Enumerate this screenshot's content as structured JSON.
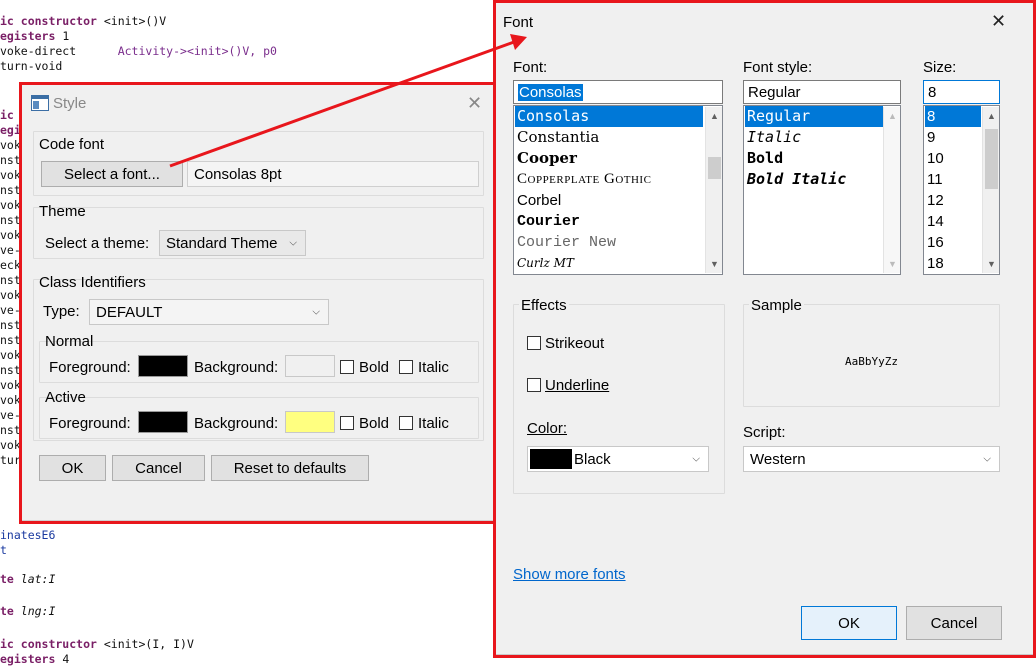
{
  "code": {
    "lines": [
      {
        "a": "ic constructor",
        "b": " <init>()V"
      },
      {
        "a": "egisters",
        "b": " 1"
      },
      {
        "a": "voke-direct",
        "b": "      Activity-><init>()V, p0"
      },
      {
        "a": "turn-void",
        "b": ""
      },
      {
        "a": "ic",
        "b": ""
      },
      {
        "a": "egi",
        "b": ""
      },
      {
        "a": "vok",
        "b": ""
      },
      {
        "a": "nst",
        "b": ""
      },
      {
        "a": "vok",
        "b": ""
      },
      {
        "a": "nst",
        "b": ""
      },
      {
        "a": "vok",
        "b": ""
      },
      {
        "a": "nst",
        "b": ""
      },
      {
        "a": "vok",
        "b": ""
      },
      {
        "a": "ve-",
        "b": ""
      },
      {
        "a": "eck",
        "b": ""
      },
      {
        "a": "nst",
        "b": ""
      },
      {
        "a": "vok",
        "b": ""
      },
      {
        "a": "ve-",
        "b": ""
      },
      {
        "a": "nst",
        "b": ""
      },
      {
        "a": "nst",
        "b": ""
      },
      {
        "a": "vok",
        "b": ""
      },
      {
        "a": "nst",
        "b": ""
      },
      {
        "a": "vok",
        "b": ""
      },
      {
        "a": "vok",
        "b": ""
      },
      {
        "a": "ve-",
        "b": ""
      },
      {
        "a": "nst",
        "b": ""
      },
      {
        "a": "vok",
        "b": ""
      },
      {
        "a": "tur",
        "b": ""
      },
      {
        "a": "inatesE6",
        "b": ""
      },
      {
        "a": "t",
        "b": ""
      },
      {
        "a": "te ",
        "b": "lat:I"
      },
      {
        "a": "te ",
        "b": "lng:I"
      },
      {
        "a": "ic constructor",
        "b": " <init>(I, I)V"
      },
      {
        "a": "egisters",
        "b": " 4"
      }
    ]
  },
  "style_dialog": {
    "title": "Style",
    "code_font": {
      "group": "Code font",
      "select_button": "Select a font...",
      "current": "Consolas 8pt"
    },
    "theme": {
      "group": "Theme",
      "label": "Select a theme:",
      "value": "Standard Theme"
    },
    "class_identifiers": {
      "group": "Class Identifiers",
      "type_label": "Type:",
      "type_value": "DEFAULT",
      "normal": {
        "group": "Normal",
        "fg_label": "Foreground:",
        "bg_label": "Background:",
        "bold": "Bold",
        "italic": "Italic",
        "fg_color": "#000000",
        "bg_color": "#f0f0f0"
      },
      "active": {
        "group": "Active",
        "fg_label": "Foreground:",
        "bg_label": "Background:",
        "bold": "Bold",
        "italic": "Italic",
        "fg_color": "#000000",
        "bg_color": "#ffff80"
      }
    },
    "buttons": {
      "ok": "OK",
      "cancel": "Cancel",
      "reset": "Reset to defaults"
    }
  },
  "font_dialog": {
    "title": "Font",
    "font": {
      "label": "Font:",
      "value": "Consolas",
      "items": [
        "Consolas",
        "Constantia",
        "Cooper",
        "Copperplate Gothic",
        "Corbel",
        "Courier",
        "Courier New",
        "Curlz MT"
      ]
    },
    "style": {
      "label": "Font style:",
      "value": "Regular",
      "items": [
        "Regular",
        "Italic",
        "Bold",
        "Bold Italic"
      ]
    },
    "size": {
      "label": "Size:",
      "value": "8",
      "items": [
        "8",
        "9",
        "10",
        "11",
        "12",
        "14",
        "16",
        "18"
      ]
    },
    "effects": {
      "group": "Effects",
      "strikeout": "Strikeout",
      "underline": "Underline",
      "color_label": "Color:",
      "color_value": "Black",
      "color_swatch": "#000000"
    },
    "sample": {
      "group": "Sample",
      "text": "AaBbYyZz"
    },
    "script": {
      "label": "Script:",
      "value": "Western"
    },
    "show_more": "Show more fonts",
    "buttons": {
      "ok": "OK",
      "cancel": "Cancel"
    }
  },
  "colors": {
    "highlight": "#e8161c",
    "selection": "#0078d7",
    "link": "#0066cc"
  },
  "icons": [
    "close-icon",
    "chevron-down-icon",
    "window-icon",
    "arrow-annotation"
  ]
}
